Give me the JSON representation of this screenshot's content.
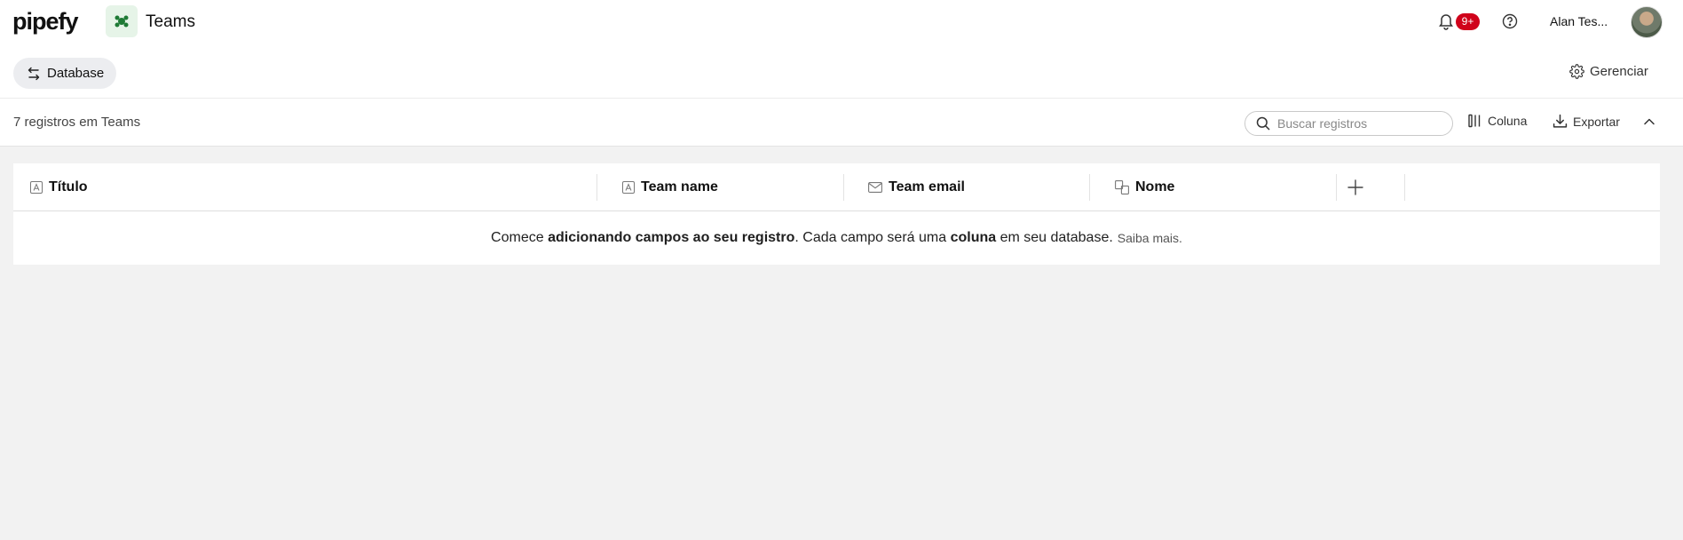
{
  "app": {
    "logo": "pipefy",
    "database_title": "Teams"
  },
  "header": {
    "notifications_badge": "9+",
    "user_name": "Alan Tes..."
  },
  "subbar": {
    "database_button": "Database",
    "manage_button": "Gerenciar"
  },
  "toolbar": {
    "record_count": "7 registros em Teams",
    "search_placeholder": "Buscar registros",
    "column_button": "Coluna",
    "export_button": "Exportar"
  },
  "table": {
    "columns": [
      {
        "label": "Título",
        "icon": "text-field-icon"
      },
      {
        "label": "Team name",
        "icon": "text-field-icon"
      },
      {
        "label": "Team email",
        "icon": "email-field-icon"
      },
      {
        "label": "Nome",
        "icon": "connection-field-icon"
      }
    ],
    "empty_message": {
      "part1": "Comece ",
      "bold1": "adicionando campos ao seu registro",
      "part2": ". Cada campo será uma ",
      "bold2": "coluna",
      "part3": " em seu database.",
      "link": "Saiba mais."
    }
  },
  "colors": {
    "badge": "#d0021b",
    "db_icon_bg": "#e6f4e8",
    "db_icon": "#1e7a35"
  }
}
